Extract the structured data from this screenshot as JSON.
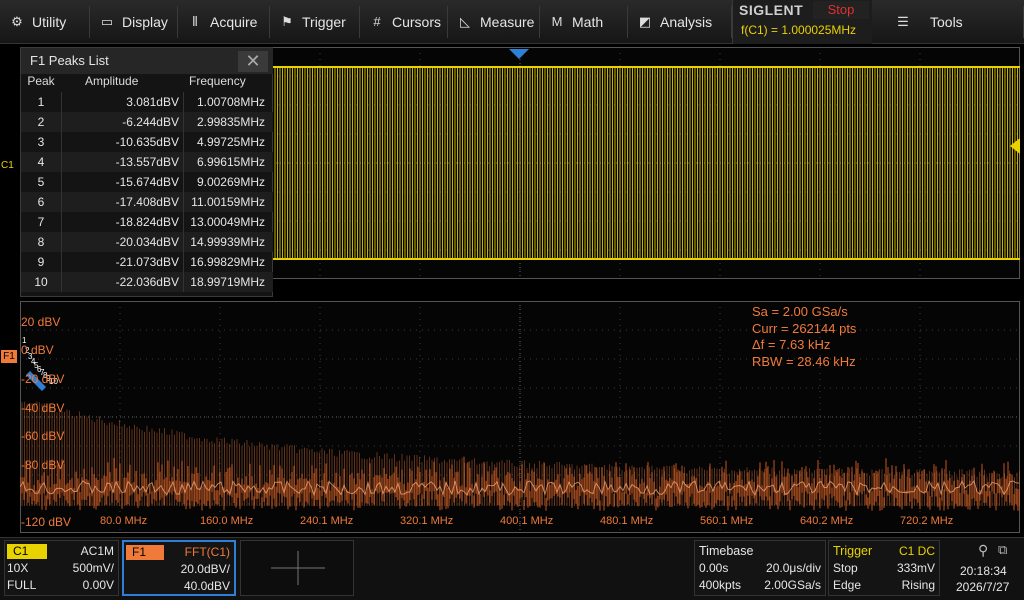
{
  "menu": [
    {
      "label": "Utility",
      "icon": "gear-icon"
    },
    {
      "label": "Display",
      "icon": "monitor-icon"
    },
    {
      "label": "Acquire",
      "icon": "acquire-icon"
    },
    {
      "label": "Trigger",
      "icon": "flag-icon"
    },
    {
      "label": "Cursors",
      "icon": "cursor-hash-icon"
    },
    {
      "label": "Measure",
      "icon": "ruler-icon"
    },
    {
      "label": "Math",
      "icon": "math-icon"
    },
    {
      "label": "Analysis",
      "icon": "analysis-icon"
    },
    {
      "label": "Tools",
      "icon": "tools-icon"
    }
  ],
  "brand": {
    "logo": "SIGLENT",
    "status": "Stop",
    "freq": "f(C1) = 1.000025MHz"
  },
  "peaks": {
    "title": "F1 Peaks List",
    "headers": {
      "peak": "Peak",
      "amplitude": "Amplitude",
      "frequency": "Frequency"
    },
    "rows": [
      {
        "peak": "1",
        "amplitude": "3.081dBV",
        "frequency": "1.00708MHz"
      },
      {
        "peak": "2",
        "amplitude": "-6.244dBV",
        "frequency": "2.99835MHz"
      },
      {
        "peak": "3",
        "amplitude": "-10.635dBV",
        "frequency": "4.99725MHz"
      },
      {
        "peak": "4",
        "amplitude": "-13.557dBV",
        "frequency": "6.99615MHz"
      },
      {
        "peak": "5",
        "amplitude": "-15.674dBV",
        "frequency": "9.00269MHz"
      },
      {
        "peak": "6",
        "amplitude": "-17.408dBV",
        "frequency": "11.00159MHz"
      },
      {
        "peak": "7",
        "amplitude": "-18.824dBV",
        "frequency": "13.00049MHz"
      },
      {
        "peak": "8",
        "amplitude": "-20.034dBV",
        "frequency": "14.99939MHz"
      },
      {
        "peak": "9",
        "amplitude": "-21.073dBV",
        "frequency": "16.99829MHz"
      },
      {
        "peak": "10",
        "amplitude": "-22.036dBV",
        "frequency": "18.99719MHz"
      }
    ]
  },
  "channel_markers": {
    "c1": "C1",
    "f1": "F1"
  },
  "fft_info": {
    "sa": "Sa =  2.00 GSa/s",
    "curr": "Curr = 262144 pts",
    "df": "Δf =  7.63 kHz",
    "rbw": "RBW =  28.46 kHz"
  },
  "fft_ylabels": [
    "20 dBV",
    "0 dBV",
    "-20 dBV",
    "-40 dBV",
    "-60 dBV",
    "-80 dBV",
    "-120 dBV"
  ],
  "fft_xlabels": [
    "80.0 MHz",
    "160.0 MHz",
    "240.1 MHz",
    "320.1 MHz",
    "400.1 MHz",
    "480.1 MHz",
    "560.1 MHz",
    "640.2 MHz",
    "720.2 MHz"
  ],
  "c1_box": {
    "tag": "C1",
    "coupling": "AC1M",
    "probe": "10X",
    "scale": "500mV/",
    "bw": "FULL",
    "offset": "0.00V"
  },
  "f1_box": {
    "tag": "F1",
    "func": "FFT(C1)",
    "scale": "20.0dBV/",
    "center": "40.0dBV"
  },
  "timebase": {
    "label": "Timebase",
    "delay": "0.00s",
    "scale": "20.0μs/div",
    "points": "400kpts",
    "rate": "2.00GSa/s"
  },
  "trigger": {
    "label": "Trigger",
    "source": "C1 DC",
    "mode": "Stop",
    "level": "333mV",
    "type": "Edge",
    "slope": "Rising"
  },
  "clock": {
    "time": "20:18:34",
    "date": "2026/7/27"
  },
  "colors": {
    "ch1": "#e8d200",
    "fft": "#f07a3a",
    "marker": "#2e7fd6"
  }
}
